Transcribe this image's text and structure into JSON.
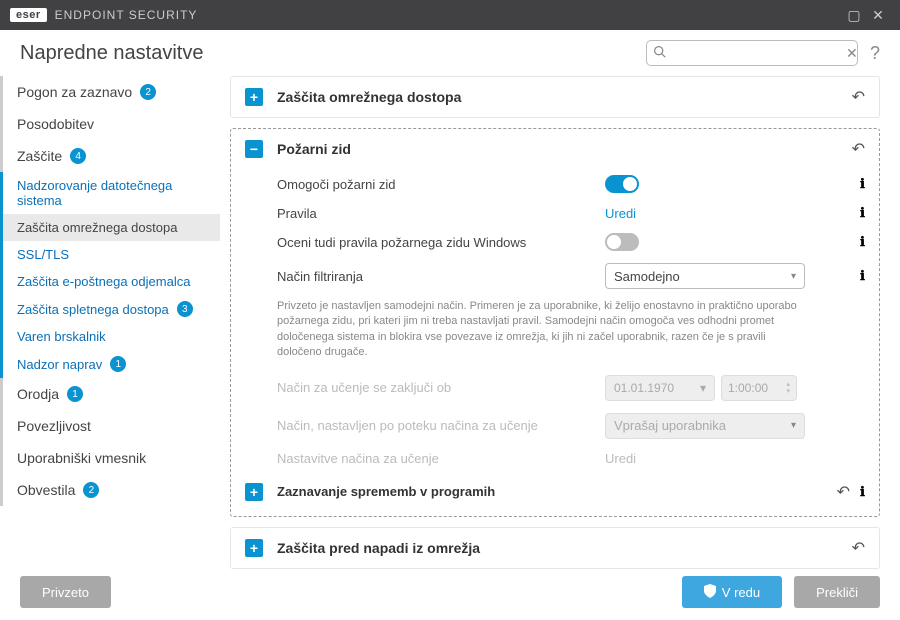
{
  "brand": {
    "logo": "eser",
    "product": "ENDPOINT SECURITY"
  },
  "window": {
    "title": "Napredne nastavitve"
  },
  "search": {
    "placeholder": ""
  },
  "sidebar": {
    "items": [
      {
        "label": "Pogon za zaznavo",
        "badge": "2",
        "type": "top"
      },
      {
        "label": "Posodobitev",
        "type": "top"
      },
      {
        "label": "Zaščite",
        "badge": "4",
        "type": "top"
      },
      {
        "label": "Nadzorovanje datotečnega sistema",
        "type": "sub"
      },
      {
        "label": "Zaščita omrežnega dostopa",
        "type": "sub",
        "active": true
      },
      {
        "label": "SSL/TLS",
        "type": "sub"
      },
      {
        "label": "Zaščita e-poštnega odjemalca",
        "type": "sub"
      },
      {
        "label": "Zaščita spletnega dostopa",
        "badge": "3",
        "type": "sub"
      },
      {
        "label": "Varen brskalnik",
        "type": "sub"
      },
      {
        "label": "Nadzor naprav",
        "badge": "1",
        "type": "sub"
      },
      {
        "label": "Orodja",
        "badge": "1",
        "type": "top"
      },
      {
        "label": "Povezljivost",
        "type": "top"
      },
      {
        "label": "Uporabniški vmesnik",
        "type": "top"
      },
      {
        "label": "Obvestila",
        "badge": "2",
        "type": "top"
      }
    ]
  },
  "panels": {
    "netaccess": {
      "title": "Zaščita omrežnega dostopa"
    },
    "firewall": {
      "title": "Požarni zid",
      "rows": {
        "enable": {
          "label": "Omogoči požarni zid",
          "value": true
        },
        "rules": {
          "label": "Pravila",
          "link": "Uredi"
        },
        "winfw": {
          "label": "Oceni tudi pravila požarnega zidu Windows",
          "value": false
        },
        "mode": {
          "label": "Način filtriranja",
          "value": "Samodejno"
        },
        "desc": "Privzeto je nastavljen samodejni način. Primeren je za uporabnike, ki želijo enostavno in praktično uporabo požarnega zidu, pri kateri jim ni treba nastavljati pravil. Samodejni način omogoča ves odhodni promet določenega sistema in blokira vse povezave iz omrežja, ki jih ni začel uporabnik, razen če je s pravili določeno drugače.",
        "learn_end": {
          "label": "Način za učenje se zaključi ob",
          "date": "01.01.1970",
          "time": "1:00:00"
        },
        "after_learn": {
          "label": "Način, nastavljen po poteku načina za učenje",
          "value": "Vprašaj uporabnika"
        },
        "learn_settings": {
          "label": "Nastavitve načina za učenje",
          "link": "Uredi"
        }
      },
      "sub": {
        "title": "Zaznavanje sprememb v programih"
      }
    },
    "netattack": {
      "title": "Zaščita pred napadi iz omrežja"
    }
  },
  "footer": {
    "default": "Privzeto",
    "ok": "V redu",
    "cancel": "Prekliči"
  }
}
